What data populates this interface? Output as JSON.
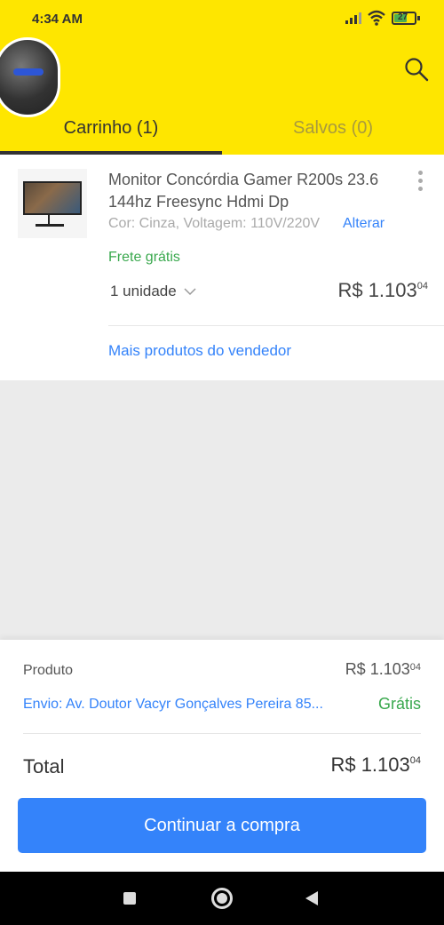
{
  "status_bar": {
    "time": "4:34 AM",
    "battery": "27",
    "icons": [
      "signal-icon",
      "wifi-icon",
      "battery-icon"
    ]
  },
  "header": {
    "search_icon": "search-icon"
  },
  "tabs": [
    {
      "label": "Carrinho (1)",
      "active": true
    },
    {
      "label": "Salvos (0)",
      "active": false
    }
  ],
  "cart_item": {
    "title": "Monitor Concórdia Gamer R200s 23.6 144hz Freesync Hdmi Dp",
    "variant": "Cor: Cinza, Voltagem: 110V/220V",
    "change_link": "Alterar",
    "shipping": "Frete grátis",
    "quantity": "1 unidade",
    "price_main": "R$ 1.103",
    "price_cents": "04",
    "more_from_seller": "Mais produtos do vendedor"
  },
  "summary": {
    "product_label": "Produto",
    "product_price_main": "R$ 1.103",
    "product_price_cents": "04",
    "shipping_address": "Envio: Av. Doutor Vacyr Gonçalves Pereira 85...",
    "shipping_price": "Grátis",
    "total_label": "Total",
    "total_main": "R$ 1.103",
    "total_cents": "04",
    "continue_button": "Continuar a compra"
  },
  "colors": {
    "brand_yellow": "#fee600",
    "link_blue": "#3483fa",
    "free_green": "#39a84d"
  }
}
